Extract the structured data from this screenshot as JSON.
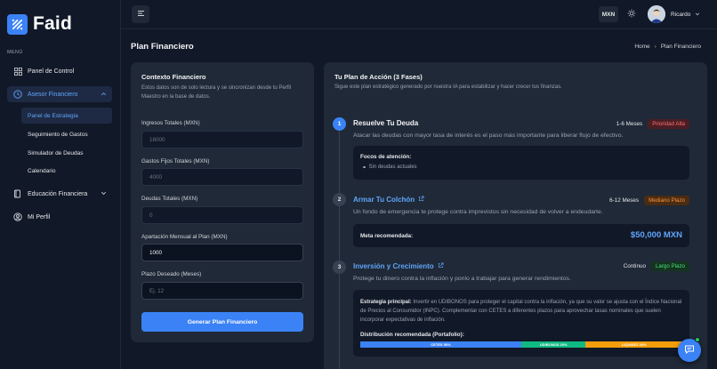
{
  "brand": {
    "name": "Faid"
  },
  "sidebar": {
    "menu_label": "MENÚ",
    "items": [
      {
        "label": "Panel de Control",
        "icon": "grid-icon"
      },
      {
        "label": "Asesor Financiero",
        "icon": "clock-icon",
        "expanded": true
      },
      {
        "label": "Educación Financiera",
        "icon": "book-icon",
        "expanded": false
      },
      {
        "label": "Mi Perfil",
        "icon": "user-icon"
      }
    ],
    "subitems": [
      {
        "label": "Panel de Estrategia",
        "active": true
      },
      {
        "label": "Seguimiento de Gastos"
      },
      {
        "label": "Simulador de Deudas"
      },
      {
        "label": "Calendario"
      }
    ]
  },
  "topbar": {
    "currency": "MXN",
    "user_name": "Ricardo"
  },
  "page": {
    "title": "Plan Financiero",
    "breadcrumb": [
      "Home",
      "Plan Financiero"
    ]
  },
  "context": {
    "title": "Contexto Financiero",
    "description": "Estos datos son de solo lectura y se sincronizan desde tu Perfil Maestro en la base de datos.",
    "fields": [
      {
        "label": "Ingresos Totales (MXN)",
        "value": "18000"
      },
      {
        "label": "Gastos Fijos Totales (MXN)",
        "value": "4000"
      },
      {
        "label": "Deudas Totales (MXN)",
        "value": "0"
      },
      {
        "label": "Apartación Mensual al Plan (MXN)",
        "value": "1000"
      },
      {
        "label": "Plazo Deseado (Meses)",
        "placeholder": "Ej. 12"
      }
    ],
    "button": "Generar Plan Financiero"
  },
  "plan": {
    "title": "Tu Plan de Acción (3 Fases)",
    "subtitle": "Sigue este plan estratégico generado por nuestra IA para estabilizar y hacer crecer tus finanzas.",
    "phases": [
      {
        "number": "1",
        "title": "Resuelve Tu Deuda",
        "duration": "1-6 Meses",
        "priority": "Prioridad Alta",
        "description": "Atacar las deudas con mayor tasa de interés es el paso más importante para liberar flujo de efectivo.",
        "focus_title": "Focos de atención:",
        "focus_items": [
          "Sin deudas actuales"
        ]
      },
      {
        "number": "2",
        "title": "Armar Tu Colchón",
        "duration": "6-12 Meses",
        "priority": "Mediano Plazo",
        "description": "Un fondo de emergencia te protege contra imprevistos sin necesidad de volver a endeudarte.",
        "goal_label": "Meta recomendada:",
        "goal_value": "$50,000 MXN"
      },
      {
        "number": "3",
        "title": "Inversión y Crecimiento",
        "duration": "Continuo",
        "priority": "Largo Plazo",
        "description": "Protege tu dinero contra la inflación y ponlo a trabajar para generar rendimientos.",
        "strategy_label": "Estrategia principal:",
        "strategy_text": "Invertir en UDIBONOS para proteger el capital contra la inflación, ya que su valor se ajusta con el Índice Nacional de Precios al Consumidor (INPC). Complementar con CETES a diferentes plazos para aprovechar tasas nominales que suelen incorporar expectativas de inflación.",
        "distribution_label": "Distribución recomendada (Portafolio):",
        "distribution": [
          {
            "label": "CETES 50%",
            "percent": 50,
            "color": "#3b82f6"
          },
          {
            "label": "UDIBONOS 20%",
            "percent": 20,
            "color": "#10b981"
          },
          {
            "label": "LIQUIDEZ 30%",
            "percent": 30,
            "color": "#f59e0b"
          }
        ]
      }
    ]
  }
}
